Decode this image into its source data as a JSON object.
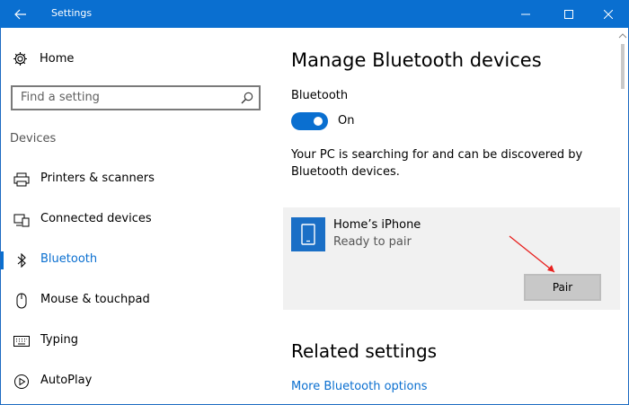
{
  "window": {
    "title": "Settings",
    "accent": "#0a6fd0"
  },
  "sidebar": {
    "home_label": "Home",
    "search_placeholder": "Find a setting",
    "section_label": "Devices",
    "items": [
      {
        "label": "Printers & scanners",
        "icon": "printer-icon"
      },
      {
        "label": "Connected devices",
        "icon": "connected-devices-icon"
      },
      {
        "label": "Bluetooth",
        "icon": "bluetooth-icon",
        "active": true
      },
      {
        "label": "Mouse & touchpad",
        "icon": "mouse-icon"
      },
      {
        "label": "Typing",
        "icon": "keyboard-icon"
      },
      {
        "label": "AutoPlay",
        "icon": "autoplay-icon"
      }
    ]
  },
  "main": {
    "title": "Manage Bluetooth devices",
    "bluetooth_label": "Bluetooth",
    "toggle_state": "On",
    "description": "Your PC is searching for and can be discovered by Bluetooth devices.",
    "device": {
      "name": "Home’s iPhone",
      "status": "Ready to pair",
      "pair_label": "Pair",
      "icon": "phone-icon"
    },
    "related_title": "Related settings",
    "related_link": "More Bluetooth options"
  }
}
